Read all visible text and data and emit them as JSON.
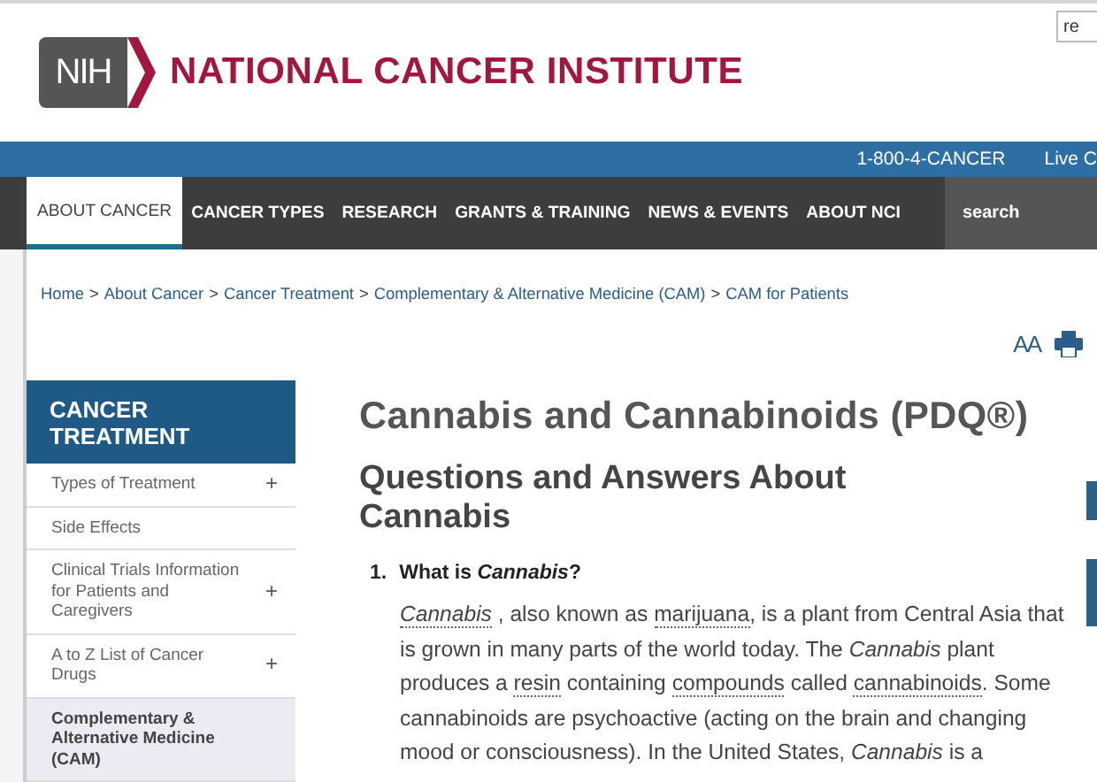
{
  "top_search": {
    "value": "re"
  },
  "logo": {
    "mark": "NIH",
    "name": "NATIONAL CANCER INSTITUTE"
  },
  "utility_bar": [
    "1-800-4-CANCER",
    "Live C"
  ],
  "nav": [
    {
      "label": "ABOUT CANCER",
      "selected": true
    },
    {
      "label": "CANCER TYPES",
      "selected": false
    },
    {
      "label": "RESEARCH",
      "selected": false
    },
    {
      "label": "GRANTS & TRAINING",
      "selected": false
    },
    {
      "label": "NEWS & EVENTS",
      "selected": false
    },
    {
      "label": "ABOUT NCI",
      "selected": false
    }
  ],
  "nav_search": {
    "placeholder": "search"
  },
  "breadcrumb": {
    "separator": ">",
    "items": [
      "Home",
      "About Cancer",
      "Cancer Treatment",
      "Complementary & Alternative Medicine (CAM)",
      "CAM for Patients"
    ]
  },
  "page_tools": {
    "text_size": "AA"
  },
  "sidebar": {
    "title": "CANCER TREATMENT",
    "items": [
      {
        "label": "Types of Treatment",
        "selected": false,
        "toggle": "+"
      },
      {
        "label": "Side Effects",
        "selected": false
      },
      {
        "label": "Clinical Trials Information for Patients and Caregivers",
        "selected": false,
        "toggle": "+"
      },
      {
        "label": "A to Z List of Cancer Drugs",
        "selected": false,
        "toggle": "+"
      },
      {
        "label": "Complementary & Alternative Medicine (CAM)",
        "selected": true
      }
    ]
  },
  "title": "Cannabis and Cannabinoids (PDQ®)",
  "section_heading": "Questions and Answers About Cannabis",
  "questions": [
    {
      "number": "1.",
      "question": "What is *Cannabis*?",
      "answer": [
        {
          "text": "Cannabis",
          "kind": "term_italic"
        },
        {
          "text": " , also known as ",
          "kind": "plain"
        },
        {
          "text": "marijuana",
          "kind": "term"
        },
        {
          "text": ", is a plant from Central Asia that is grown in many parts of the world today. The ",
          "kind": "plain"
        },
        {
          "text": "Cannabis",
          "kind": "italic"
        },
        {
          "text": " plant produces a ",
          "kind": "plain"
        },
        {
          "text": "resin",
          "kind": "term"
        },
        {
          "text": " containing ",
          "kind": "plain"
        },
        {
          "text": "compounds",
          "kind": "term"
        },
        {
          "text": " called ",
          "kind": "plain"
        },
        {
          "text": "cannabinoids",
          "kind": "term"
        },
        {
          "text": ". Some cannabinoids are psychoactive (acting on the brain and changing mood or consciousness). In the United States, ",
          "kind": "plain"
        },
        {
          "text": "Cannabis",
          "kind": "italic"
        },
        {
          "text": " is a",
          "kind": "plain"
        }
      ]
    }
  ]
}
